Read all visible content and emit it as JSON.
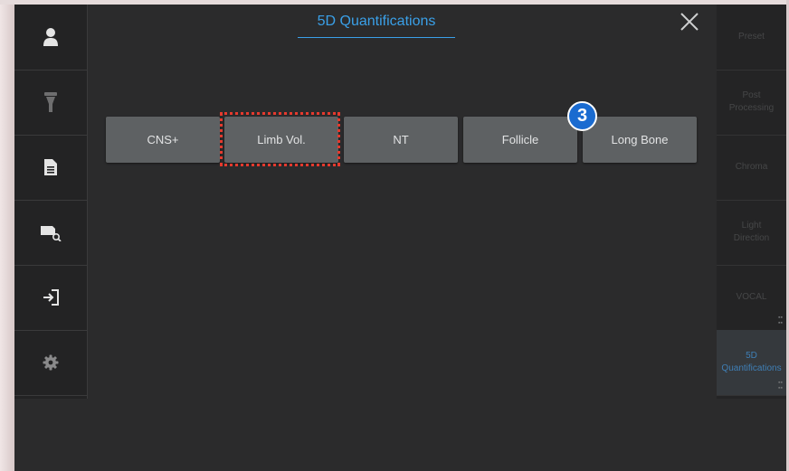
{
  "header": {
    "title": "5D Quantifications"
  },
  "left_sidebar": {
    "items": [
      {
        "icon": "user-icon"
      },
      {
        "icon": "probe-icon"
      },
      {
        "icon": "document-icon"
      },
      {
        "icon": "image-search-icon"
      },
      {
        "icon": "exit-icon"
      },
      {
        "icon": "gear-icon"
      }
    ]
  },
  "quantifications": {
    "buttons": [
      "CNS+",
      "Limb Vol.",
      "NT",
      "Follicle",
      "Long Bone"
    ],
    "highlighted": "Limb Vol."
  },
  "step_badge": "3",
  "right_panel": {
    "items": [
      "Preset",
      "Post Processing",
      "Chroma",
      "Light Direction",
      "VOCAL",
      "5D Quantifications"
    ],
    "active": "5D Quantifications"
  },
  "colors": {
    "accent": "#3aa0e8",
    "highlight": "#e53a2e",
    "badge": "#1a6bd0",
    "button": "#5e6163"
  }
}
